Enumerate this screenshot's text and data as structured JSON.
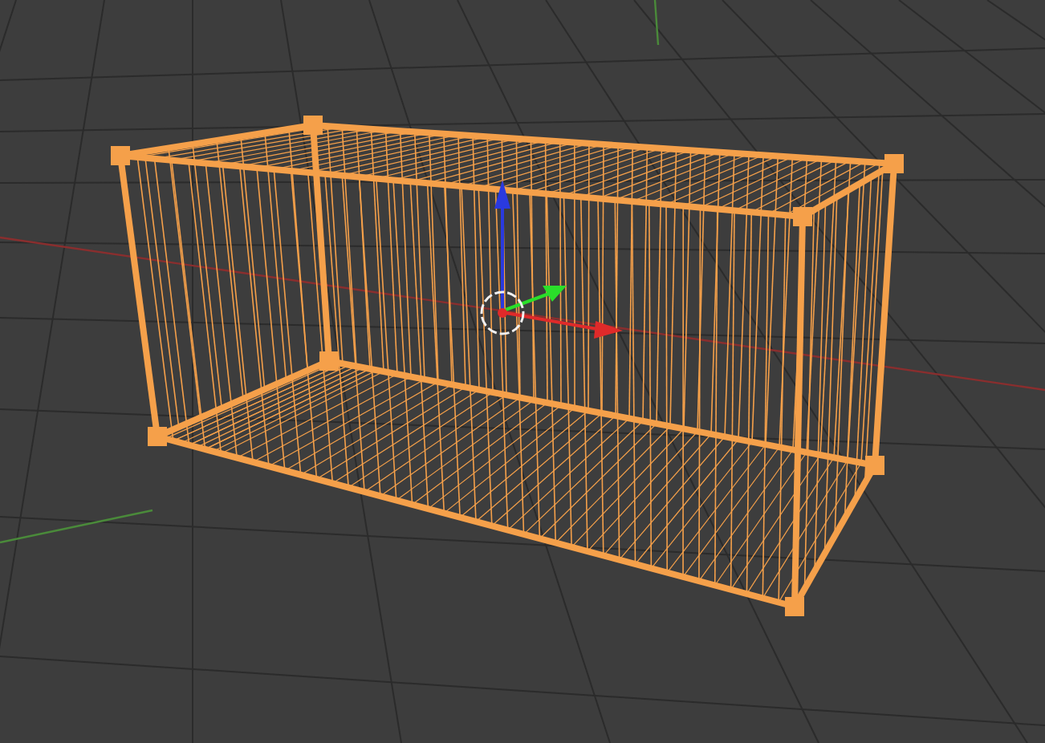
{
  "viewport": {
    "grid": {
      "visible": true
    },
    "object": {
      "selected": true
    }
  }
}
